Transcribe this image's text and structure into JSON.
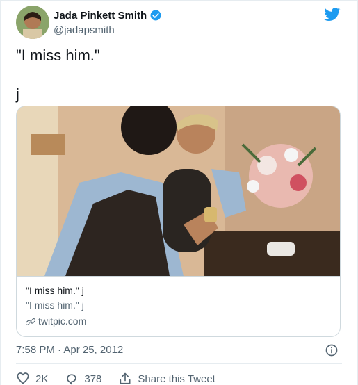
{
  "author": {
    "name": "Jada Pinkett Smith",
    "handle": "@jadapsmith"
  },
  "tweet": {
    "line1": "\"I miss him.\"",
    "line2": "j"
  },
  "card": {
    "title": "\"I miss him.\" j",
    "description": "\"I miss him.\" j",
    "domain": "twitpic.com"
  },
  "meta": {
    "timestamp": "7:58 PM · Apr 25, 2012"
  },
  "actions": {
    "likes": "2K",
    "replies": "378",
    "share_label": "Share this Tweet"
  },
  "colors": {
    "accent": "#1d9bf0",
    "secondary_text": "#536471"
  },
  "icons": {
    "verified": "verified-badge-icon",
    "bird": "twitter-bird-icon",
    "info": "info-icon",
    "like": "heart-icon",
    "reply": "reply-icon",
    "share": "share-icon",
    "link": "link-icon"
  }
}
